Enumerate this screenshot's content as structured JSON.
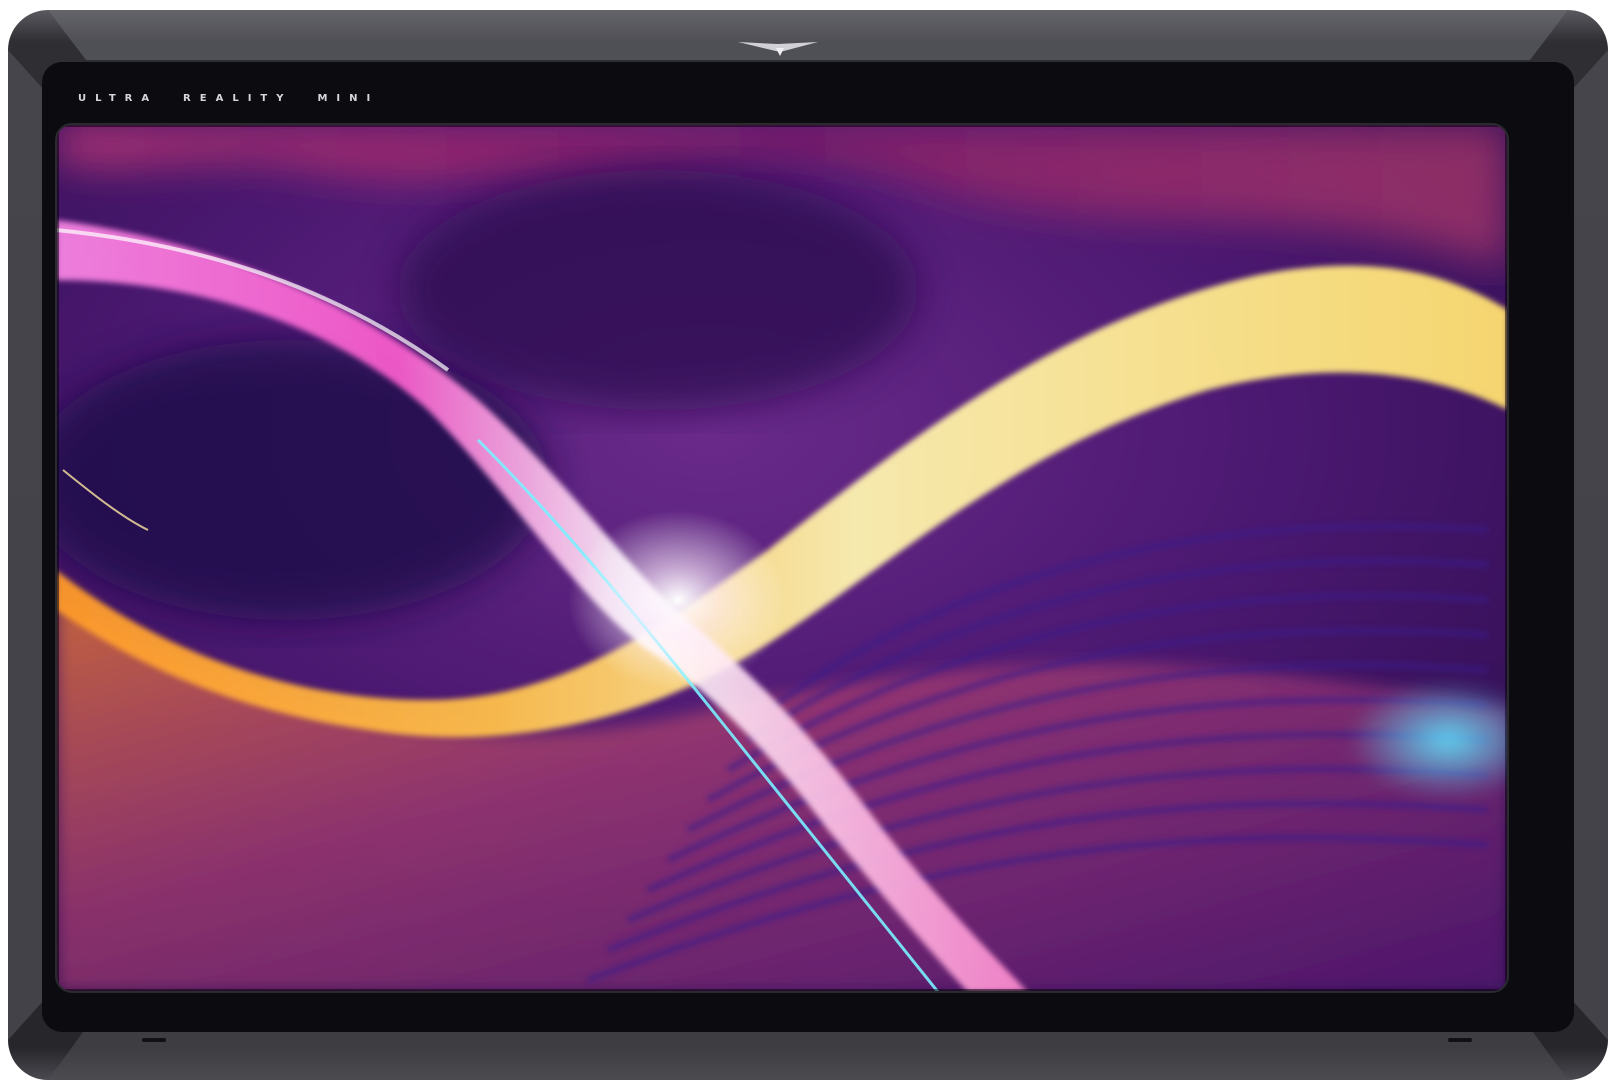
{
  "device": {
    "brand_text": "ULTRA  REALITY  MINI",
    "logo": "chevron-logo-icon"
  },
  "colors": {
    "bezel_outer": "#2a2a2e",
    "bezel_inner": "#0c0b10",
    "wave_pink": "#ff5fd0",
    "wave_yellow": "#ffe98a",
    "wave_orange": "#ff9a2a",
    "wave_cyan": "#5fe4ff",
    "background_purple": "#3a1060"
  }
}
